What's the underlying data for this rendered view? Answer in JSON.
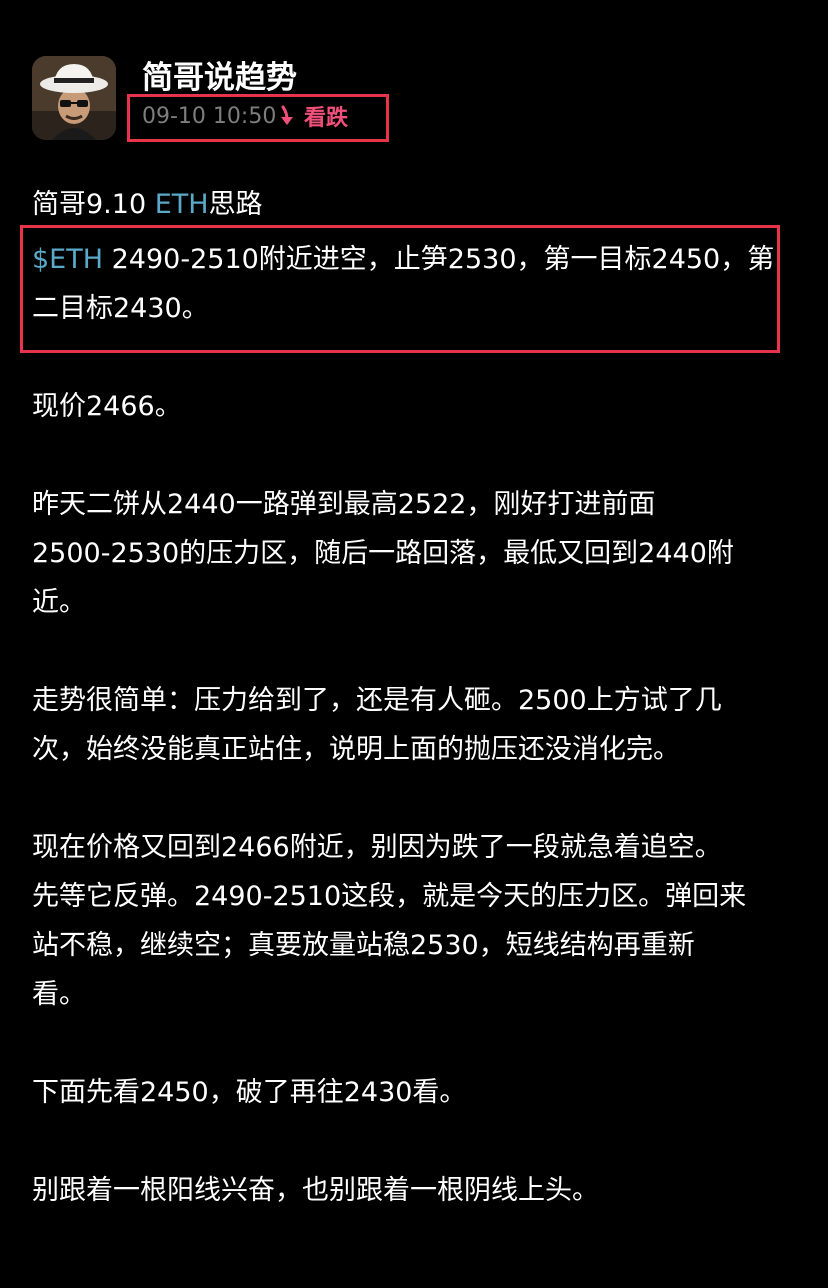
{
  "author": {
    "name": "简哥说趋势",
    "avatar_icon": "avatar-photo-man-white-hat-sunglasses"
  },
  "meta": {
    "timestamp": "09-10 10:50",
    "sentiment_label": "看跌",
    "sentiment_icon": "arrow-down-icon",
    "sentiment_color": "#f0507a",
    "highlight_color": "#e8344a"
  },
  "post": {
    "title_prefix": "简哥9.10 ",
    "title_link": "ETH",
    "title_suffix": "思路",
    "signal_ticker": "$ETH",
    "signal_line1": " 2490-2510附近进空，止笋2530，第一目标2450，第",
    "signal_line2": "二目标2430。",
    "p1": "现价2466。",
    "p2_l1": "昨天二饼从2440一路弹到最高2522，刚好打进前面",
    "p2_l2": "2500-2530的压力区，随后一路回落，最低又回到2440附",
    "p2_l3": "近。",
    "p3_l1": "走势很简单：压力给到了，还是有人砸。2500上方试了几",
    "p3_l2": "次，始终没能真正站住，说明上面的抛压还没消化完。",
    "p4_l1": "现在价格又回到2466附近，别因为跌了一段就急着追空。",
    "p4_l2": "先等它反弹。2490-2510这段，就是今天的压力区。弹回来",
    "p4_l3": "站不稳，继续空；真要放量站稳2530，短线结构再重新",
    "p4_l4": "看。",
    "p5": "下面先看2450，破了再往2430看。",
    "p6": "别跟着一根阳线兴奋，也别跟着一根阴线上头。"
  },
  "colors": {
    "background": "#000000",
    "text": "#ffffff",
    "link": "#5aa9c8",
    "timestamp": "#7d7d7d"
  }
}
